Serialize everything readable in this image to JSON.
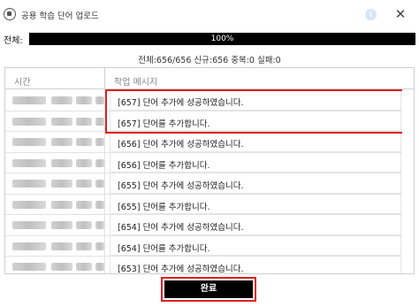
{
  "window": {
    "title": "공용 학습 단어 업로드",
    "info_glyph": "i",
    "close_glyph": "✕"
  },
  "progress": {
    "label": "전체:",
    "percent_text": "100%",
    "fraction": 1.0
  },
  "summary": "전체:656/656 신규:656 중복:0 실패:0",
  "table": {
    "headers": {
      "time": "시간",
      "message": "작업 메시지"
    },
    "rows": [
      {
        "message": "[657] 단어 추가에 성공하였습니다."
      },
      {
        "message": "[657] 단어를 추가합니다."
      },
      {
        "message": "[656] 단어 추가에 성공하였습니다."
      },
      {
        "message": "[656] 단어를 추가합니다."
      },
      {
        "message": "[655] 단어 추가에 성공하였습니다."
      },
      {
        "message": "[655] 단어를 추가합니다."
      },
      {
        "message": "[654] 단어 추가에 성공하였습니다."
      },
      {
        "message": "[654] 단어를 추가합니다."
      },
      {
        "message": "[653] 단어 추가에 성공하였습니다."
      }
    ]
  },
  "footer": {
    "done_label": "완료"
  },
  "colors": {
    "highlight": "#e02020",
    "progress_fill": "#000000",
    "button_bg": "#000000"
  }
}
